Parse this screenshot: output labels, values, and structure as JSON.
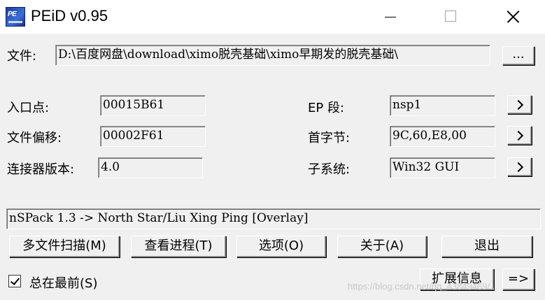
{
  "window": {
    "title": "PEiD v0.95",
    "icon_text": "PE"
  },
  "file": {
    "label": "文件:",
    "path": "D:\\百度网盘\\download\\ximo脱壳基础\\ximo早期发的脱壳基础\\",
    "browse_label": "..."
  },
  "info": {
    "entry_point_label": "入口点:",
    "entry_point_value": "00015B61",
    "file_offset_label": "文件偏移:",
    "file_offset_value": "00002F61",
    "linker_version_label": "连接器版本:",
    "linker_version_value": "4.0",
    "ep_section_label": "EP 段:",
    "ep_section_value": "nsp1",
    "first_bytes_label": "首字节:",
    "first_bytes_value": "9C,60,E8,00",
    "subsystem_label": "子系统:",
    "subsystem_value": "Win32 GUI"
  },
  "result": "nSPack 1.3 -> North Star/Liu Xing Ping [Overlay]",
  "buttons": {
    "multi_scan": "多文件扫描(M)",
    "task_viewer": "查看进程(T)",
    "options": "选项(O)",
    "about": "关于(A)",
    "exit": "退出",
    "extra_info": "扩展信息",
    "plugins": "=>"
  },
  "always_on_top": {
    "label": "总在最前(S)",
    "checked": true
  },
  "watermark": "https://blog.csdn.net/qq_43849469/..."
}
